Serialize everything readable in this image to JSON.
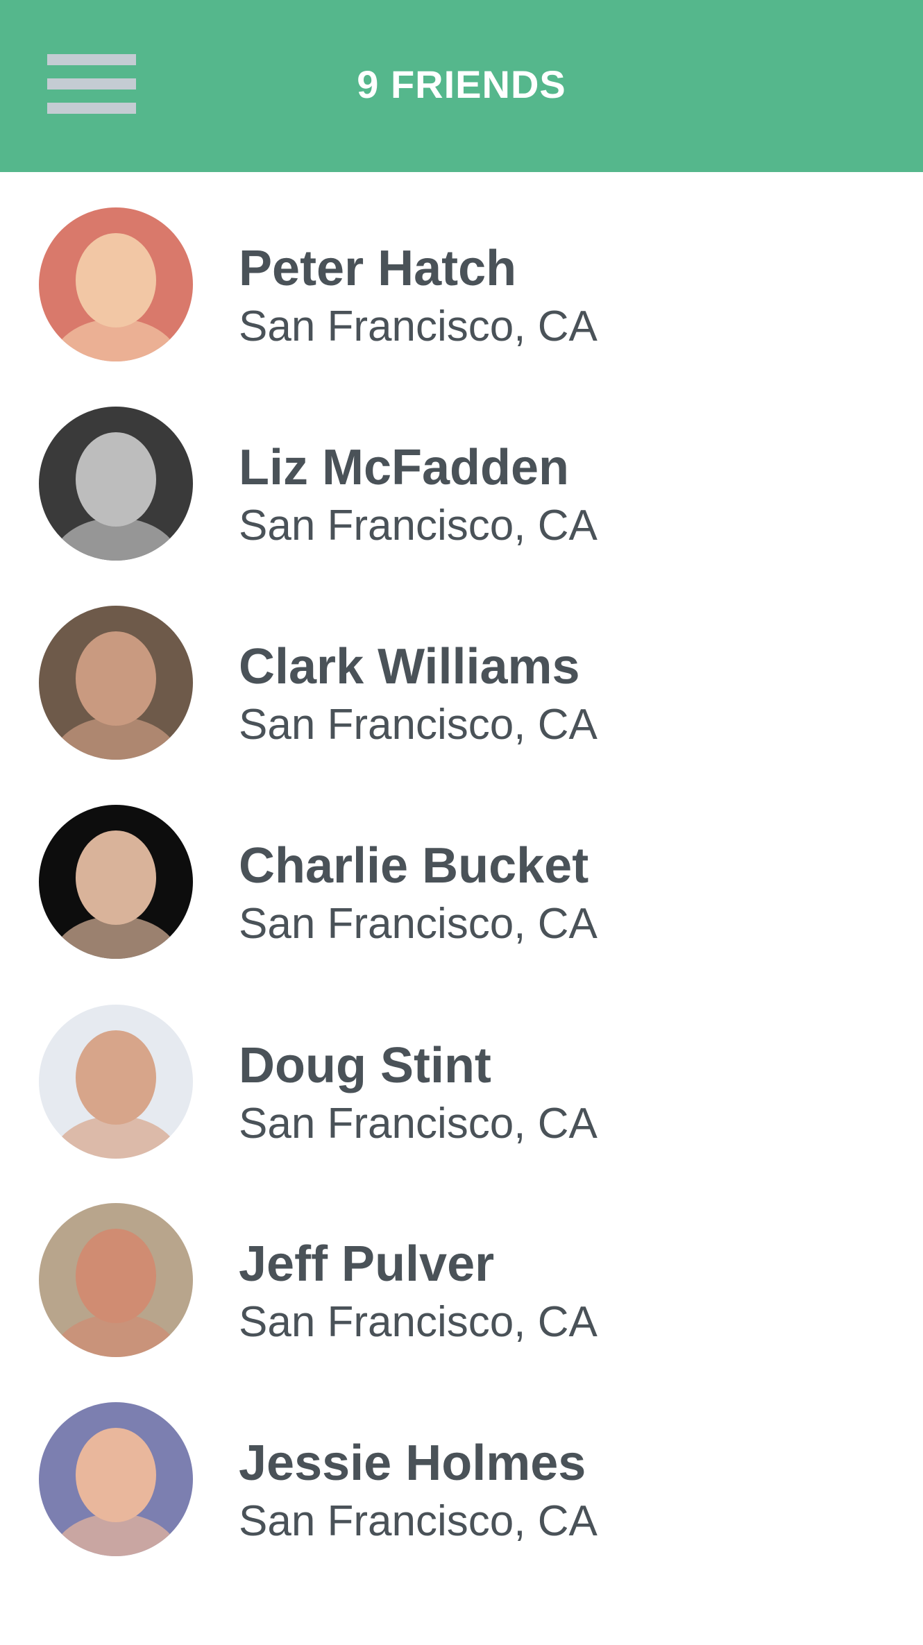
{
  "header": {
    "title": "9 FRIENDS",
    "menu_icon": "hamburger-menu-icon",
    "background_color": "#55b78c"
  },
  "friends": [
    {
      "name": "Peter Hatch",
      "location": "San Francisco, CA",
      "avatar_icon": "avatar-photo",
      "avatar_bg": "#d9796b",
      "avatar_fg": "#f2c7a5"
    },
    {
      "name": "Liz McFadden",
      "location": "San Francisco, CA",
      "avatar_icon": "avatar-photo",
      "avatar_bg": "#3a3a3a",
      "avatar_fg": "#bdbdbd"
    },
    {
      "name": "Clark Williams",
      "location": "San Francisco, CA",
      "avatar_icon": "avatar-photo",
      "avatar_bg": "#6e5a4a",
      "avatar_fg": "#c99a80"
    },
    {
      "name": "Charlie Bucket",
      "location": "San Francisco, CA",
      "avatar_icon": "avatar-photo",
      "avatar_bg": "#0d0d0d",
      "avatar_fg": "#d9b39a"
    },
    {
      "name": "Doug Stint",
      "location": "San Francisco, CA",
      "avatar_icon": "avatar-photo",
      "avatar_bg": "#e6eaf0",
      "avatar_fg": "#d7a58a"
    },
    {
      "name": "Jeff Pulver",
      "location": "San Francisco, CA",
      "avatar_icon": "avatar-photo",
      "avatar_bg": "#b8a58c",
      "avatar_fg": "#d08c72"
    },
    {
      "name": "Jessie Holmes",
      "location": "San Francisco, CA",
      "avatar_icon": "avatar-photo",
      "avatar_bg": "#7c7fb0",
      "avatar_fg": "#e9b79c"
    }
  ]
}
